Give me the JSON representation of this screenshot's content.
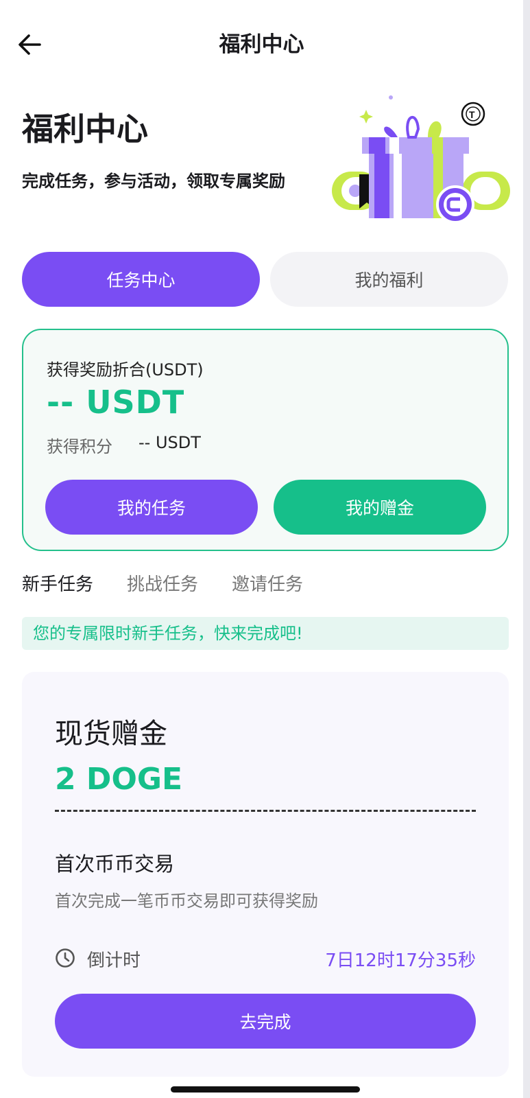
{
  "nav": {
    "title": "福利中心"
  },
  "hero": {
    "title": "福利中心",
    "subtitle": "完成任务，参与活动，领取专属奖励"
  },
  "segments": [
    {
      "label": "任务中心",
      "active": true
    },
    {
      "label": "我的福利",
      "active": false
    }
  ],
  "summary": {
    "label": "获得奖励折合(USDT)",
    "value": "-- USDT",
    "points_label": "获得积分",
    "points_value": "-- USDT",
    "my_tasks_button": "我的任务",
    "my_bonus_button": "我的赠金"
  },
  "task_tabs": [
    {
      "label": "新手任务",
      "active": true
    },
    {
      "label": "挑战任务",
      "active": false
    },
    {
      "label": "邀请任务",
      "active": false
    }
  ],
  "notice": "您的专属限时新手任务，快来完成吧!",
  "task": {
    "title": "现货赠金",
    "amount": "2 DOGE",
    "name": "首次币币交易",
    "description": "首次完成一笔币币交易即可获得奖励",
    "countdown_label": "倒计时",
    "countdown_value": "7日12时17分35秒",
    "action_button": "去完成"
  },
  "colors": {
    "primary": "#7a4df3",
    "green": "#16bf8a",
    "lime": "#c7e94a"
  }
}
